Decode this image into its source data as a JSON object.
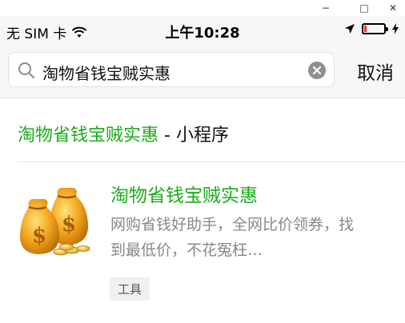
{
  "window": {
    "minimize_glyph": "−",
    "maximize_glyph": "□",
    "close_glyph": "✕"
  },
  "status_bar": {
    "carrier": "无 SIM 卡",
    "time": "上午10:28",
    "battery_color": "#e53935"
  },
  "search": {
    "query": "淘物省钱宝贼实惠",
    "cancel_label": "取消"
  },
  "results": {
    "section_highlight": "淘物省钱宝贼实惠",
    "section_suffix": " - 小程序",
    "items": [
      {
        "name": "淘物省钱宝贼实惠",
        "description": "网购省钱好助手，全网比价领券，找到最低价，不花冤枉…",
        "tag": "工具",
        "icon": "money-bags-icon"
      }
    ]
  },
  "colors": {
    "highlight_green": "#1aad19",
    "background": "#f7f7f7"
  }
}
